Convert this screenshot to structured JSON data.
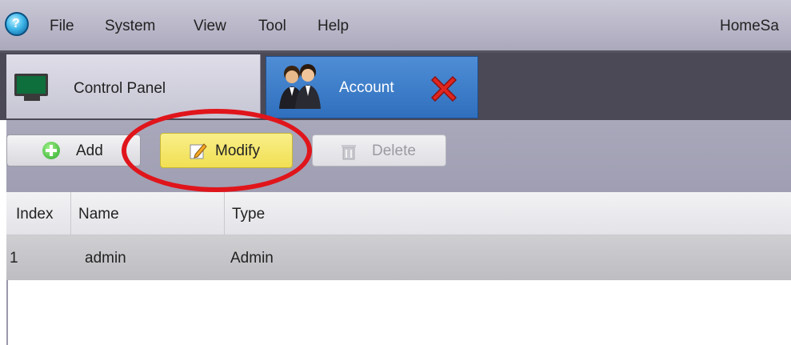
{
  "menubar": {
    "items": [
      {
        "label": "File"
      },
      {
        "label": "System"
      },
      {
        "label": "View"
      },
      {
        "label": "Tool"
      },
      {
        "label": "Help"
      }
    ],
    "app_name": "HomeSa"
  },
  "tabs": [
    {
      "label": "Control Panel",
      "icon": "monitor-icon"
    },
    {
      "label": "Account",
      "icon": "users-icon",
      "active": true
    }
  ],
  "toolbar": {
    "add_label": "Add",
    "modify_label": "Modify",
    "delete_label": "Delete",
    "highlighted": "Modify"
  },
  "table": {
    "columns": [
      "Index",
      "Name",
      "Type"
    ],
    "rows": [
      [
        "1",
        "admin",
        "Admin"
      ]
    ]
  },
  "colors": {
    "active_tab": "#3f7fcb",
    "highlight_ring": "#e0151b",
    "modify_button": "#f1df53"
  }
}
